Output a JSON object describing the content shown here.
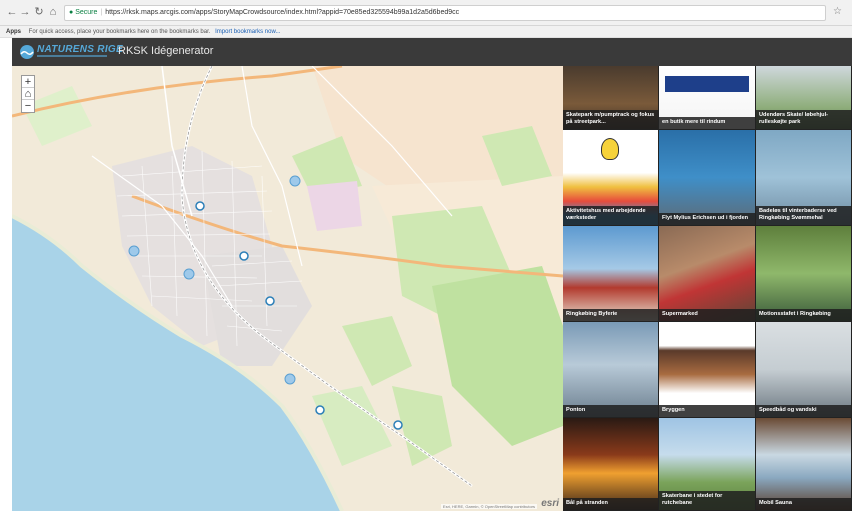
{
  "browser": {
    "secure_label": "Secure",
    "url": "https://rksk.maps.arcgis.com/apps/StoryMapCrowdsource/index.html?appid=70e85ed325594b99a1d2a5d6bed9cc",
    "bookmarks": {
      "apps_label": "Apps",
      "hint": "For quick access, place your bookmarks here on the bookmarks bar.",
      "import_link": "Import bookmarks now..."
    }
  },
  "header": {
    "logo_text": "NATURENS RIGE",
    "title": "RKSK Idégenerator"
  },
  "map": {
    "zoom_in": "+",
    "home": "⌂",
    "zoom_out": "−",
    "esri": "esri",
    "attribution": "Esri, HERE, Garmin, © OpenStreetMap contributors"
  },
  "tiles": [
    {
      "caption": "Skatepark m/pumptrack og fokus på streetpark...",
      "palette": "skate"
    },
    {
      "caption": "en butik mere til rindum",
      "palette": "rema"
    },
    {
      "caption": "Udendørs Skate/ løbehjul-rulleskøjte park",
      "palette": "outdoor"
    },
    {
      "caption": "Aktivitetshus med arbejdende værksteder",
      "palette": "hands"
    },
    {
      "caption": "Flyt Mylius Erichsen ud i fjorden",
      "palette": "statue"
    },
    {
      "caption": "Badeløs til vinterbaderse ved Ringkøbing Svømmehal",
      "palette": "pier"
    },
    {
      "caption": "Ringkøbing Byferie",
      "palette": "houses"
    },
    {
      "caption": "Supermarked",
      "palette": "supermarket"
    },
    {
      "caption": "Motionsstafet i Ringkøbing",
      "palette": "runners"
    },
    {
      "caption": "Ponton",
      "palette": "pontoon"
    },
    {
      "caption": "Bryggen",
      "palette": "bryggen"
    },
    {
      "caption": "Speedbåd og vandski",
      "palette": "speedboat"
    },
    {
      "caption": "Bål på stranden",
      "palette": "fire"
    },
    {
      "caption": "Skaterbane i stedet for rutchebane",
      "palette": "kids"
    },
    {
      "caption": "Mobil Sauna",
      "palette": "sauna"
    }
  ]
}
